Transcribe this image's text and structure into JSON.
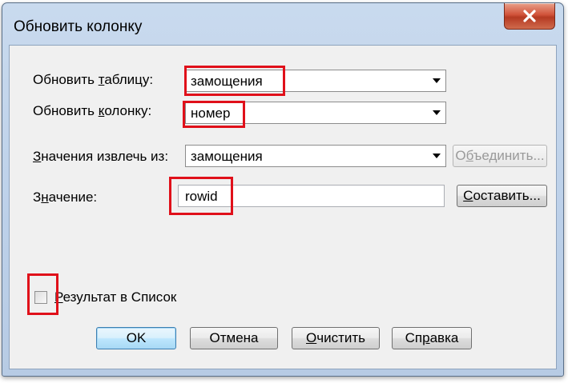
{
  "window": {
    "title": "Обновить колонку"
  },
  "form": {
    "update_table": {
      "label_pre": "Обновить ",
      "label_u": "т",
      "label_post": "аблицу:",
      "value": "замощения"
    },
    "update_column": {
      "label_pre": "Обновить ",
      "label_u": "к",
      "label_post": "олонку:",
      "value": "номер"
    },
    "source": {
      "label_u": "З",
      "label_post": "начения извлечь из:",
      "value": "замощения",
      "join_pre": "О",
      "join_u": "б",
      "join_post": "ъединить..."
    },
    "value_field": {
      "label_pre": "З",
      "label_u": "н",
      "label_post": "ачение:",
      "value": "rowid",
      "build_u": "С",
      "build_post": "оставить..."
    },
    "result_checkbox": {
      "label_u": "Р",
      "label_post": "езультат в Список",
      "checked": false
    }
  },
  "buttons": {
    "ok": "OK",
    "cancel": "Отмена",
    "clear_u": "О",
    "clear_post": "чистить",
    "help_pre": "Сп",
    "help_u": "р",
    "help_post": "авка"
  },
  "colors": {
    "highlight": "#e0101a",
    "titlebar": "#c9daee",
    "close_button": "#c8462c"
  }
}
